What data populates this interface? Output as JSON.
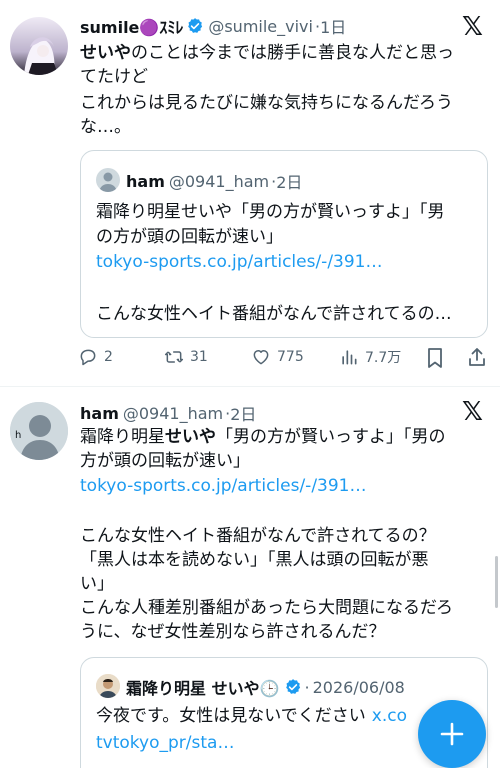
{
  "tweet1": {
    "author_name": "sumile🟣ｽﾐﾚ",
    "handle": "@sumile_vivi",
    "time": "1日",
    "line1_bold": "せいや",
    "line1_rest": "のことは今までは勝手に善良な人だと思っ",
    "line2": "てたけど",
    "line3": "これからは見るたびに嫌な気持ちになるんだろう",
    "line4": "な…。",
    "quote": {
      "author_name": "ham",
      "handle": "@0941_ham",
      "time": "2日",
      "line1": "霜降り明星せいや「男の方が賢いっすよ」「男",
      "line2": "の方が頭の回転が速い」",
      "link": "tokyo-sports.co.jp/articles/-/391…",
      "line3": "こんな女性ヘイト番組がなんで許されてるの…"
    },
    "actions": {
      "replies": "2",
      "retweets": "31",
      "likes": "775",
      "views": "7.7万"
    }
  },
  "tweet2": {
    "avatar_letter": "h",
    "author_name": "ham",
    "handle": "@0941_ham",
    "time": "2日",
    "line1_a": "霜降り明星",
    "line1_bold": "せいや",
    "line1_b": "「男の方が賢いっすよ」「男の",
    "line2": "方が頭の回転が速い」",
    "link": "tokyo-sports.co.jp/articles/-/391…",
    "line3": "こんな女性ヘイト番組がなんで許されてるの？",
    "line4": "「黒人は本を読めない」「黒人は頭の回転が悪",
    "line5": "い」",
    "line6": "こんな人種差別番組があったら大問題になるだろ",
    "line7": "うに、なぜ女性差別なら許されるんだ？",
    "quote": {
      "author_name": "霜降り明星 せいや🕒",
      "time": "2026/06/08",
      "line1": "今夜です。女性は見ないでください",
      "link1": "x.co",
      "line2": "tvtokyo_pr/sta…"
    }
  },
  "colors": {
    "link": "#1d9bf0",
    "verified": "#1d9bf0",
    "secondary_text": "#536471"
  }
}
